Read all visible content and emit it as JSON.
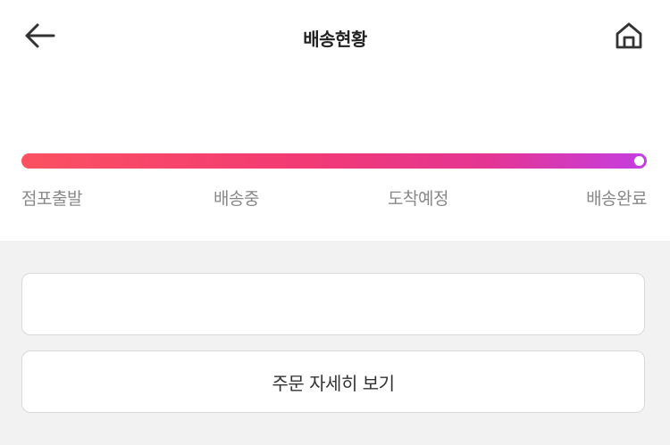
{
  "header": {
    "title": "배송현황",
    "back_icon": "arrow-left-icon",
    "home_icon": "home-icon"
  },
  "progress": {
    "steps": [
      "점포출발",
      "배송중",
      "도착예정",
      "배송완료"
    ],
    "current_step_index": 3,
    "fill_fraction": 1.0,
    "gradient_colors": [
      "#fb5161",
      "#f23a74",
      "#e43594",
      "#c43ee2"
    ]
  },
  "actions": {
    "order_detail_label": "주문 자세히 보기"
  },
  "colors": {
    "background_gray": "#f2f2f2",
    "step_text": "#888888"
  }
}
